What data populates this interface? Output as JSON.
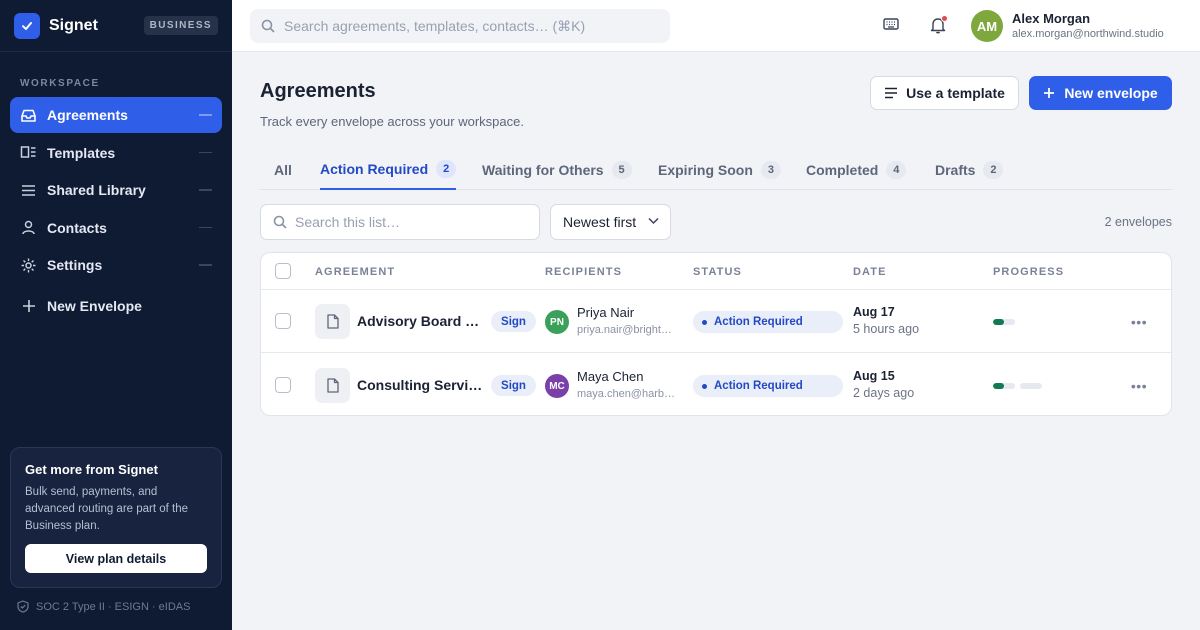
{
  "app": {
    "name": "Signet",
    "plan_badge": "BUSINESS"
  },
  "sidebar": {
    "section_label": "WORKSPACE",
    "items": [
      {
        "label": "Agreements",
        "icon": "inbox-icon",
        "active": true
      },
      {
        "label": "Templates",
        "icon": "template-icon",
        "active": false
      },
      {
        "label": "Shared Library",
        "icon": "library-icon",
        "active": false
      },
      {
        "label": "Contacts",
        "icon": "user-icon",
        "active": false
      },
      {
        "label": "Settings",
        "icon": "gear-icon",
        "active": false
      }
    ],
    "new_envelope": "New Envelope",
    "promo": {
      "title": "Get more from Signet",
      "text": "Bulk send, payments, and advanced routing are part of the Business plan.",
      "button": "View plan details"
    },
    "compliance": "SOC 2 Type II · ESIGN · eIDAS"
  },
  "topbar": {
    "search_placeholder": "Search agreements, templates, contacts…  (⌘K)",
    "user": {
      "initials": "AM",
      "name": "Alex Morgan",
      "email": "alex.morgan@northwind.studio"
    }
  },
  "page": {
    "title": "Agreements",
    "subtitle": "Track every envelope across your workspace.",
    "use_template": "Use a template",
    "new_envelope": "New envelope"
  },
  "tabs": [
    {
      "label": "All",
      "count": null,
      "active": false
    },
    {
      "label": "Action Required",
      "count": "2",
      "active": true
    },
    {
      "label": "Waiting for Others",
      "count": "5",
      "active": false
    },
    {
      "label": "Expiring Soon",
      "count": "3",
      "active": false
    },
    {
      "label": "Completed",
      "count": "4",
      "active": false
    },
    {
      "label": "Drafts",
      "count": "2",
      "active": false
    }
  ],
  "list": {
    "search_placeholder": "Search this list…",
    "sort": "Newest first",
    "count_label": "2 envelopes",
    "columns": [
      "AGREEMENT",
      "RECIPIENTS",
      "STATUS",
      "DATE",
      "PROGRESS"
    ],
    "rows": [
      {
        "name": "Advisory Board …",
        "action": "Sign",
        "recipient": {
          "initials": "PN",
          "name": "Priya Nair",
          "email": "priya.nair@bright…",
          "color": "#3aa05a"
        },
        "status": "Action Required",
        "date": "Aug 17",
        "relative": "5 hours ago",
        "progress_segments": [
          0.5
        ]
      },
      {
        "name": "Consulting Servi…",
        "action": "Sign",
        "recipient": {
          "initials": "MC",
          "name": "Maya Chen",
          "email": "maya.chen@harb…",
          "color": "#7a3fa8"
        },
        "status": "Action Required",
        "date": "Aug 15",
        "relative": "2 days ago",
        "progress_segments": [
          0.5,
          0
        ]
      }
    ]
  },
  "colors": {
    "accent": "#2f5fe8",
    "sidebar_bg": "#0f1a33",
    "progress": "#117a52"
  }
}
